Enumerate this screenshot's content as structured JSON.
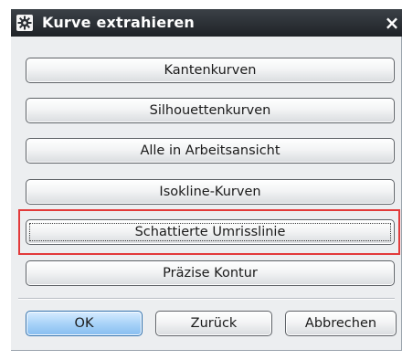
{
  "dialog": {
    "title": "Kurve extrahieren",
    "close_glyph": "×",
    "title_icon": "gear-icon"
  },
  "options": [
    {
      "label": "Kantenkurven"
    },
    {
      "label": "Silhouettenkurven"
    },
    {
      "label": "Alle in Arbeitsansicht"
    },
    {
      "label": "Isokline-Kurven"
    },
    {
      "label": "Schattierte Umrisslinie"
    },
    {
      "label": "Präzise Kontur"
    }
  ],
  "footer": {
    "ok_label": "OK",
    "back_label": "Zurück",
    "cancel_label": "Abbrechen"
  },
  "colors": {
    "highlight": "#e23a3a",
    "ok_accent": "#86bdf0",
    "titlebar": "#2a2f34"
  }
}
